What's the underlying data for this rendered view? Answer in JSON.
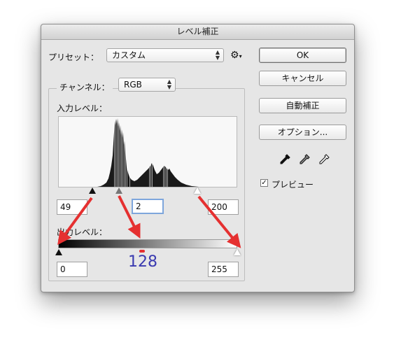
{
  "dialog": {
    "title": "レベル補正"
  },
  "preset": {
    "label": "プリセット：",
    "value": "カスタム",
    "gear_icon": "gear-icon"
  },
  "channel": {
    "label": "チャンネル：",
    "value": "RGB"
  },
  "input_levels": {
    "label": "入力レベル：",
    "black": "49",
    "mid": "2",
    "white": "200"
  },
  "output_levels": {
    "label": "出力レベル：",
    "black": "0",
    "white": "255"
  },
  "annotation": {
    "value_text": "128",
    "arrow_color": "#e53030",
    "text_color": "#3a3ab0"
  },
  "buttons": {
    "ok": "OK",
    "cancel": "キャンセル",
    "auto": "自動補正",
    "options": "オプション..."
  },
  "preview": {
    "label": "プレビュー",
    "checked": true
  }
}
